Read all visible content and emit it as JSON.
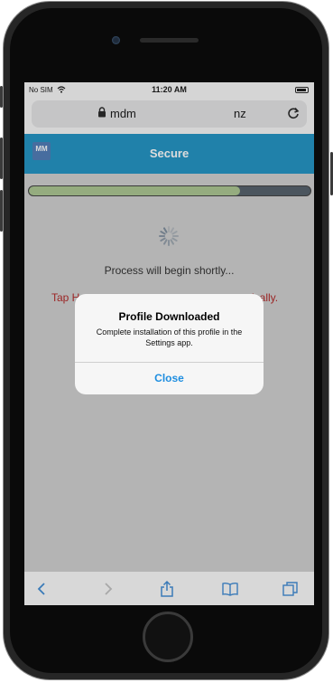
{
  "status_bar": {
    "carrier": "No SIM",
    "time": "11:20 AM"
  },
  "url_bar": {
    "domain_part1": "mdm",
    "domain_part2": "nz"
  },
  "app": {
    "logo_text": "MM",
    "header_title": "Secure",
    "progress_fraction": 0.75,
    "process_text": "Process will begin shortly...",
    "tap_text_left": "Tap H",
    "tap_text_right": "ically."
  },
  "alert": {
    "title": "Profile Downloaded",
    "message": "Complete installation of this profile in the Settings app.",
    "close_label": "Close"
  },
  "colors": {
    "header_blue": "#1a91c3",
    "progress_green": "#a9c58e",
    "alert_button_blue": "#1e8ee0",
    "warning_red": "#b02020"
  },
  "icons": {
    "lock": "lock-icon",
    "reload": "reload-icon",
    "wifi": "wifi-icon",
    "battery": "battery-icon",
    "spinner": "loading-spinner-icon",
    "back": "chevron-left-icon",
    "forward": "chevron-right-icon",
    "share": "share-icon",
    "bookmarks": "book-icon",
    "tabs": "tabs-icon"
  }
}
